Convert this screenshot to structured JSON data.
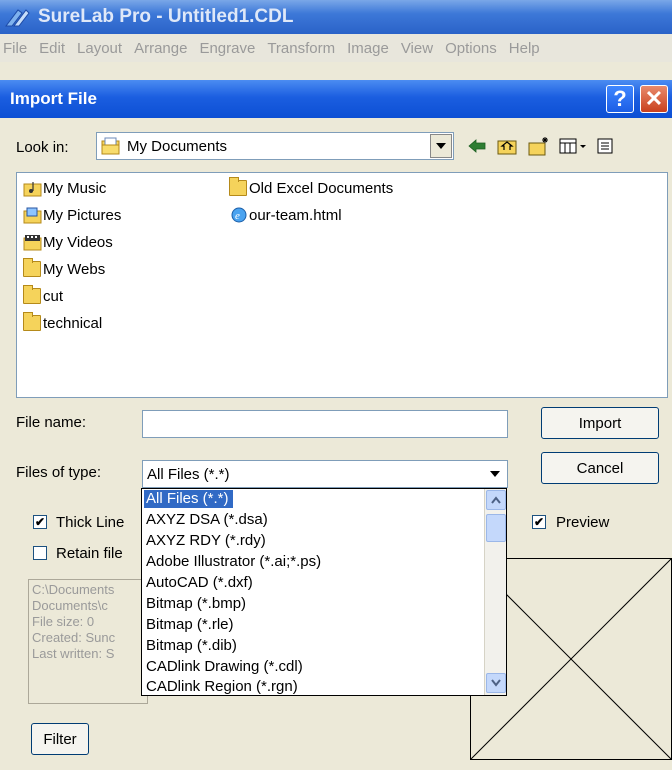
{
  "app": {
    "title": "SureLab Pro - Untitled1.CDL"
  },
  "menu": [
    "File",
    "Edit",
    "Layout",
    "Arrange",
    "Engrave",
    "Transform",
    "Image",
    "View",
    "Options",
    "Help"
  ],
  "dialog": {
    "title": "Import File",
    "help_label": "?",
    "close_label": "✕",
    "look_in_label": "Look in:",
    "look_in_value": "My Documents",
    "files_col1": [
      "My Music",
      "My Pictures",
      "My Videos",
      "My Webs",
      "cut",
      "technical"
    ],
    "files_col2": [
      "Old Excel Documents",
      "our-team.html"
    ],
    "file_name_label": "File name:",
    "file_name_value": "",
    "files_of_type_label": "Files of type:",
    "files_of_type_value": "All Files (*.*)",
    "import_label": "Import",
    "cancel_label": "Cancel",
    "thick_lines_label": "Thick Line",
    "thick_lines_checked": true,
    "retain_label": "Retain file",
    "retain_checked": false,
    "preview_label": "Preview",
    "preview_checked": true,
    "info_lines": [
      "C:\\Documents",
      "Documents\\c",
      "File size: 0",
      "Created: Sunc",
      "Last written: S"
    ],
    "filter_label": "Filter",
    "type_options": [
      "All Files (*.*)",
      "AXYZ DSA (*.dsa)",
      "AXYZ RDY (*.rdy)",
      "Adobe Illustrator (*.ai;*.ps)",
      "AutoCAD (*.dxf)",
      "Bitmap (*.bmp)",
      "Bitmap (*.rle)",
      "Bitmap (*.dib)",
      "CADlink Drawing (*.cdl)",
      "CADlink Region (*.rgn)"
    ]
  },
  "colors": {
    "title_bar": "#0c4fd4",
    "dialog_bg": "#ece9d8",
    "selection": "#316ac5"
  }
}
